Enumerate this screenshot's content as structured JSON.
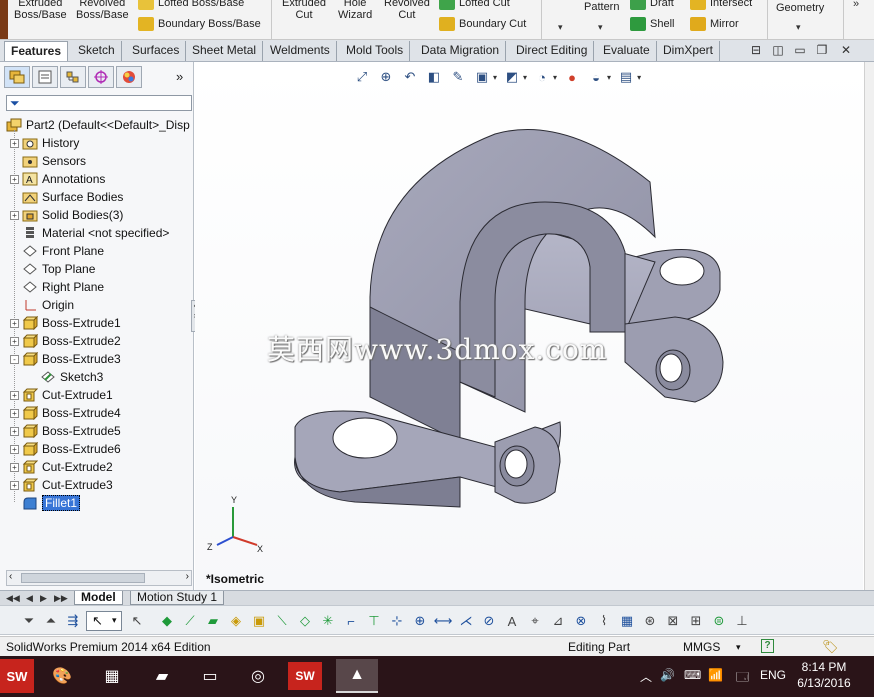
{
  "ribbon": {
    "extruded_boss_l1": "Extruded",
    "extruded_boss_l2": "Boss/Base",
    "revolved_boss_l1": "Revolved",
    "revolved_boss_l2": "Boss/Base",
    "lofted_boss": "Lofted Boss/Base",
    "boundary_boss": "Boundary Boss/Base",
    "extruded_cut_l1": "Extruded",
    "extruded_cut_l2": "Cut",
    "hole_wizard_l1": "Hole",
    "hole_wizard_l2": "Wizard",
    "revolved_cut_l1": "Revolved",
    "revolved_cut_l2": "Cut",
    "lofted_cut": "Lofted Cut",
    "boundary_cut": "Boundary Cut",
    "pattern": "Pattern",
    "draft": "Draft",
    "intersect": "Intersect",
    "shell": "Shell",
    "mirror": "Mirror",
    "reference_geometry": "Geometry"
  },
  "tabs": [
    "Features",
    "Sketch",
    "Surfaces",
    "Sheet Metal",
    "Weldments",
    "Mold Tools",
    "Data Migration",
    "Direct Editing",
    "Evaluate",
    "DimXpert"
  ],
  "feature_tree": {
    "root": "Part2  (Default<<Default>_Disp",
    "items": [
      {
        "label": "History",
        "icon": "history-folder-icon",
        "expand": "+"
      },
      {
        "label": "Sensors",
        "icon": "sensors-icon",
        "expand": ""
      },
      {
        "label": "Annotations",
        "icon": "annotations-icon",
        "expand": "+"
      },
      {
        "label": "Surface Bodies",
        "icon": "surface-bodies-icon",
        "expand": ""
      },
      {
        "label": "Solid Bodies(3)",
        "icon": "solid-bodies-icon",
        "expand": "+"
      },
      {
        "label": "Material <not specified>",
        "icon": "material-icon",
        "expand": ""
      },
      {
        "label": "Front Plane",
        "icon": "plane-icon",
        "expand": ""
      },
      {
        "label": "Top Plane",
        "icon": "plane-icon",
        "expand": ""
      },
      {
        "label": "Right Plane",
        "icon": "plane-icon",
        "expand": ""
      },
      {
        "label": "Origin",
        "icon": "origin-icon",
        "expand": ""
      },
      {
        "label": "Boss-Extrude1",
        "icon": "boss-extrude-icon",
        "expand": "+"
      },
      {
        "label": "Boss-Extrude2",
        "icon": "boss-extrude-icon",
        "expand": "+"
      },
      {
        "label": "Boss-Extrude3",
        "icon": "boss-extrude-icon",
        "expand": "-"
      },
      {
        "label": "Sketch3",
        "icon": "sketch-icon",
        "expand": "",
        "indent": true
      },
      {
        "label": "Cut-Extrude1",
        "icon": "cut-extrude-icon",
        "expand": "+"
      },
      {
        "label": "Boss-Extrude4",
        "icon": "boss-extrude-icon",
        "expand": "+"
      },
      {
        "label": "Boss-Extrude5",
        "icon": "boss-extrude-icon",
        "expand": "+"
      },
      {
        "label": "Boss-Extrude6",
        "icon": "boss-extrude-icon",
        "expand": "+"
      },
      {
        "label": "Cut-Extrude2",
        "icon": "cut-extrude-icon",
        "expand": "+"
      },
      {
        "label": "Cut-Extrude3",
        "icon": "cut-extrude-icon",
        "expand": "+"
      },
      {
        "label": "Fillet1",
        "icon": "fillet-icon",
        "expand": "",
        "selected": true
      }
    ]
  },
  "viewport": {
    "watermark": "莫西网www.3dmox.com",
    "view_name": "*Isometric",
    "triad": {
      "x": "X",
      "y": "Y",
      "z": "Z"
    }
  },
  "model_tabs": [
    "Model",
    "Motion Study 1"
  ],
  "status_bar": {
    "app": "SolidWorks Premium 2014 x64 Edition",
    "mode": "Editing Part",
    "units": "MMGS",
    "units_arrow": "▾",
    "help": "?"
  },
  "taskbar": {
    "language": "ENG",
    "time": "8:14 PM",
    "date": "6/13/2016"
  },
  "colors": {
    "part_face": "#9c9db0",
    "part_top": "#b9bacb",
    "selection_blue": "#3875d7",
    "taskbar": "#2a1418"
  }
}
